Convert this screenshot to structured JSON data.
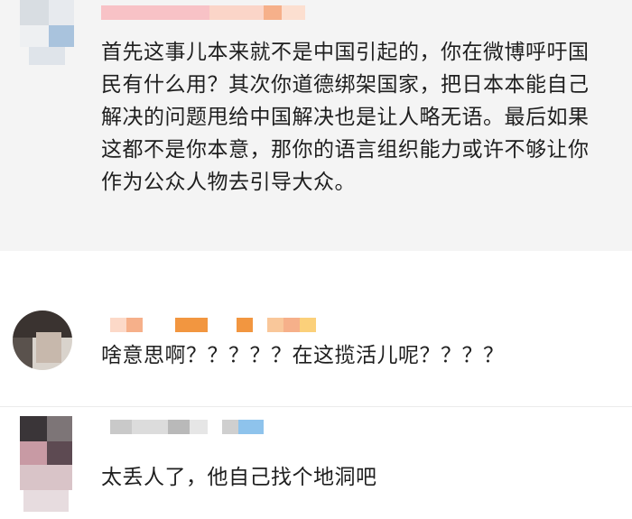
{
  "comments": [
    {
      "username": "",
      "text": "首先这事儿本来就不是中国引起的，你在微博呼吁国民有什么用？其次你道德绑架国家，把日本本能自己解决的问题甩给中国解决也是让人略无语。最后如果这都不是你本意，那你的语言组织能力或许不够让你作为公众人物去引导大众。"
    },
    {
      "username": "",
      "text": "啥意思啊？？？？？在这揽活儿呢？？？？"
    },
    {
      "username": "",
      "text": "太丢人了，他自己找个地洞吧"
    }
  ],
  "colors": {
    "highlight_bg": "#f4f4f4",
    "text": "#1f1f1f",
    "username_blur": [
      "#f6b08a",
      "#f29640",
      "#fbd07a",
      "#8ec3ec",
      "#c9c9c9"
    ]
  }
}
